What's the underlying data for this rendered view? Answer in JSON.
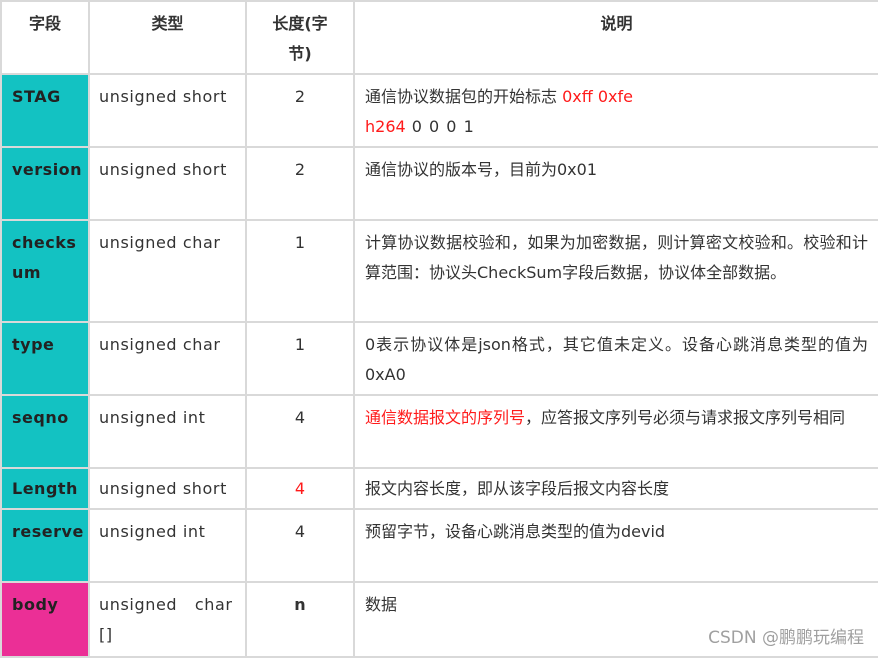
{
  "table": {
    "headers": [
      "字段",
      "类型",
      "长度(字节)",
      "说明"
    ],
    "rows": [
      {
        "field": "STAG",
        "type": "unsigned short",
        "length": "2",
        "desc_parts": [
          {
            "text": "通信协议数据包的开始标志 ",
            "highlight": false
          },
          {
            "text": "0xff 0xfe",
            "highlight": true
          },
          {
            "text": "\n",
            "highlight": false
          },
          {
            "text": "h264",
            "highlight": true
          },
          {
            "text": " 0 0 0 1",
            "highlight": false
          }
        ]
      },
      {
        "field": "version",
        "type": "unsigned short",
        "length": "2",
        "desc": "通信协议的版本号，目前为0x01"
      },
      {
        "field": "checksum",
        "type": "unsigned char",
        "length": "1",
        "desc": "计算协议数据校验和，如果为加密数据，则计算密文校验和。校验和计算范围：协议头CheckSum字段后数据，协议体全部数据。"
      },
      {
        "field": "type",
        "type": "unsigned char",
        "length": "1",
        "desc": "0表示协议体是json格式，其它值未定义。设备心跳消息类型的值为0xA0"
      },
      {
        "field": "seqno",
        "type": "unsigned int",
        "length": "4",
        "desc_highlight": "通信数据报文的序列号",
        "desc_rest": "，应答报文序列号必须与请求报文序列号相同"
      },
      {
        "field": "Length",
        "type": "unsigned short",
        "length": "4",
        "length_highlight": true,
        "desc": "报文内容长度，即从该字段后报文内容长度"
      },
      {
        "field": "reserve",
        "type": "unsigned int",
        "length": "4",
        "desc": "预留字节，设备心跳消息类型的值为devid"
      },
      {
        "field": "body",
        "type": "unsigned char []",
        "length": "n",
        "desc": "数据"
      }
    ]
  },
  "colors": {
    "header_field_bg": "#13c2c2",
    "body_field_bg": "#eb2f96",
    "highlight_text": "#ff1a1a",
    "border": "#d9d9d9"
  },
  "watermark": "CSDN @鹏鹏玩编程"
}
